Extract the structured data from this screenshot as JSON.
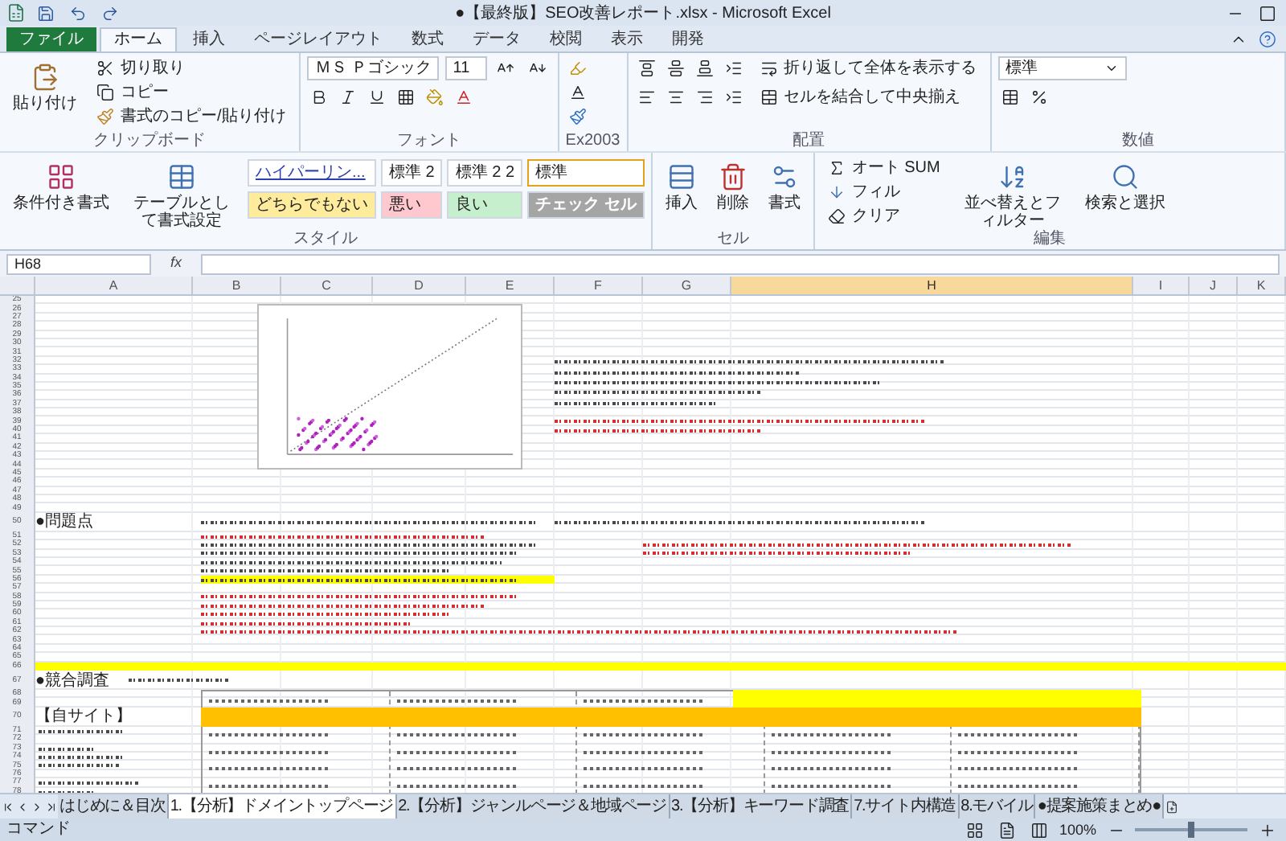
{
  "window": {
    "title": "●【最終版】SEO改善レポート.xlsx - Microsoft Excel"
  },
  "ribbon_tabs": [
    {
      "label": "ファイル",
      "kind": "file",
      "selected": false
    },
    {
      "label": "ホーム",
      "kind": "tab",
      "selected": true
    },
    {
      "label": "挿入",
      "kind": "tab",
      "selected": false
    },
    {
      "label": "ページレイアウト",
      "kind": "tab",
      "selected": false
    },
    {
      "label": "数式",
      "kind": "tab",
      "selected": false
    },
    {
      "label": "データ",
      "kind": "tab",
      "selected": false
    },
    {
      "label": "校閲",
      "kind": "tab",
      "selected": false
    },
    {
      "label": "表示",
      "kind": "tab",
      "selected": false
    },
    {
      "label": "開発",
      "kind": "tab",
      "selected": false
    }
  ],
  "clipboard": {
    "paste": "貼り付け",
    "cut": "切り取り",
    "copy": "コピー",
    "format_painter": "書式のコピー/貼り付け",
    "label": "クリップボード"
  },
  "font": {
    "name": "ＭＳ Ｐゴシック",
    "size": "11",
    "label": "フォント"
  },
  "ex2003": {
    "label": "Ex2003"
  },
  "alignment": {
    "wrap": "折り返して全体を表示する",
    "merge": "セルを結合して中央揃え",
    "label": "配置"
  },
  "number": {
    "format": "標準",
    "label": "数値"
  },
  "styles": {
    "conditional": "条件付き書式",
    "table": "テーブルとして書式設定",
    "label": "スタイル",
    "cell_styles": [
      {
        "label": "ハイパーリン...",
        "kind": "link",
        "color": "#ffffff",
        "selected": false
      },
      {
        "label": "標準 2",
        "kind": "plain",
        "color": "#ffffff",
        "selected": false
      },
      {
        "label": "標準 2 2",
        "kind": "plain",
        "color": "#ffffff",
        "selected": false
      },
      {
        "label": "標準",
        "kind": "plain",
        "color": "#ffffff",
        "selected": true
      },
      {
        "label": "どちらでもない",
        "kind": "plain",
        "color": "#ffeb9c",
        "selected": false
      },
      {
        "label": "悪い",
        "kind": "plain",
        "color": "#ffc7ce",
        "selected": false
      },
      {
        "label": "良い",
        "kind": "plain",
        "color": "#c6efce",
        "selected": false
      },
      {
        "label": "チェック セル",
        "kind": "inverse",
        "color": "#a5a5a5",
        "selected": false
      }
    ]
  },
  "cells": {
    "insert": "挿入",
    "delete": "削除",
    "format": "書式",
    "label": "セル"
  },
  "editing": {
    "autosum": "オート SUM",
    "fill": "フィル",
    "clear": "クリア",
    "sort": "並べ替えとフィルター",
    "find": "検索と選択",
    "label": "編集"
  },
  "formula_bar": {
    "name_box": "H68",
    "fx": "fx"
  },
  "columns": [
    {
      "label": "A",
      "selected": false
    },
    {
      "label": "B",
      "selected": false
    },
    {
      "label": "C",
      "selected": false
    },
    {
      "label": "D",
      "selected": false
    },
    {
      "label": "E",
      "selected": false
    },
    {
      "label": "F",
      "selected": false
    },
    {
      "label": "G",
      "selected": false
    },
    {
      "label": "H",
      "selected": true
    },
    {
      "label": "I",
      "selected": false
    },
    {
      "label": "J",
      "selected": false
    },
    {
      "label": "K",
      "selected": false
    }
  ],
  "rows": [
    {
      "number": "25"
    },
    {
      "number": "26"
    },
    {
      "number": "27"
    },
    {
      "number": "28"
    },
    {
      "number": "29"
    },
    {
      "number": "30"
    },
    {
      "number": "31"
    },
    {
      "number": "32"
    },
    {
      "number": "33"
    },
    {
      "number": "34"
    },
    {
      "number": "35"
    },
    {
      "number": "36"
    },
    {
      "number": "37"
    },
    {
      "number": "38"
    },
    {
      "number": "39"
    },
    {
      "number": "40"
    },
    {
      "number": "41"
    },
    {
      "number": "42"
    },
    {
      "number": "43"
    },
    {
      "number": "44"
    },
    {
      "number": "45"
    },
    {
      "number": "46"
    },
    {
      "number": "47"
    },
    {
      "number": "48"
    },
    {
      "number": "49"
    },
    {
      "number": "50",
      "label": "●問題点"
    },
    {
      "number": "51"
    },
    {
      "number": "52"
    },
    {
      "number": "53"
    },
    {
      "number": "54"
    },
    {
      "number": "55"
    },
    {
      "number": "56"
    },
    {
      "number": "57"
    },
    {
      "number": "58"
    },
    {
      "number": "59"
    },
    {
      "number": "60"
    },
    {
      "number": "61"
    },
    {
      "number": "62"
    },
    {
      "number": "63"
    },
    {
      "number": "64"
    },
    {
      "number": "65"
    },
    {
      "number": "66"
    },
    {
      "number": "67",
      "label": "●競合調査"
    },
    {
      "number": "68"
    },
    {
      "number": "69"
    },
    {
      "number": "70",
      "label": "【自サイト】"
    },
    {
      "number": "71"
    },
    {
      "number": "72"
    },
    {
      "number": "73"
    },
    {
      "number": "74"
    },
    {
      "number": "75"
    },
    {
      "number": "76"
    },
    {
      "number": "77"
    },
    {
      "number": "78"
    }
  ],
  "sheet_tabs": [
    {
      "label": "はじめに＆目次",
      "selected": false
    },
    {
      "label": "1.【分析】ドメイントップページ",
      "selected": true
    },
    {
      "label": "2.【分析】ジャンルページ＆地域ページ",
      "selected": false
    },
    {
      "label": "3.【分析】キーワード調査",
      "selected": false
    },
    {
      "label": "7.サイト内構造",
      "selected": false
    },
    {
      "label": "8.モバイル",
      "selected": false
    },
    {
      "label": "●提案施策まとめ●",
      "selected": false
    }
  ],
  "status_bar": {
    "mode": "コマンド",
    "zoom": "100%",
    "zoom_slider": {
      "level": 0.5
    }
  }
}
